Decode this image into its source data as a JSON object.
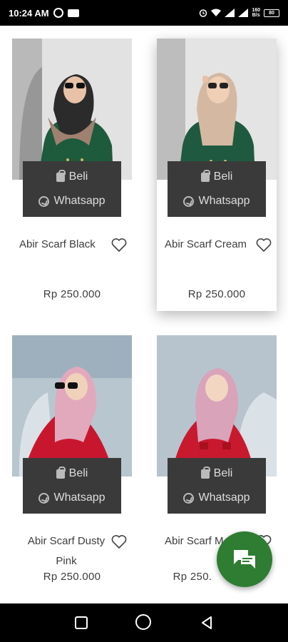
{
  "status_bar": {
    "time": "10:24 AM",
    "speed_value": "160",
    "speed_unit": "B/s",
    "battery": "80"
  },
  "products": [
    {
      "name": "Abir Scarf Black",
      "price": "Rp 250.000",
      "beli_label": "Beli",
      "whatsapp_label": "Whatsapp"
    },
    {
      "name": "Abir Scarf Cream",
      "price": "Rp 250.000",
      "beli_label": "Beli",
      "whatsapp_label": "Whatsapp"
    },
    {
      "name": "Abir Scarf Dusty Pink",
      "price": "Rp 250.000",
      "beli_label": "Beli",
      "whatsapp_label": "Whatsapp"
    },
    {
      "name": "Abir Scarf M",
      "price": "Rp 250.",
      "beli_label": "Beli",
      "whatsapp_label": "Whatsapp"
    }
  ],
  "colors": {
    "button_panel": "#3a3a3a",
    "fab": "#2e7d32"
  },
  "icons": {
    "fab": "chat-icon",
    "beli": "shopping-bag-icon",
    "whatsapp": "whatsapp-icon",
    "favorite": "heart-outline-icon"
  }
}
